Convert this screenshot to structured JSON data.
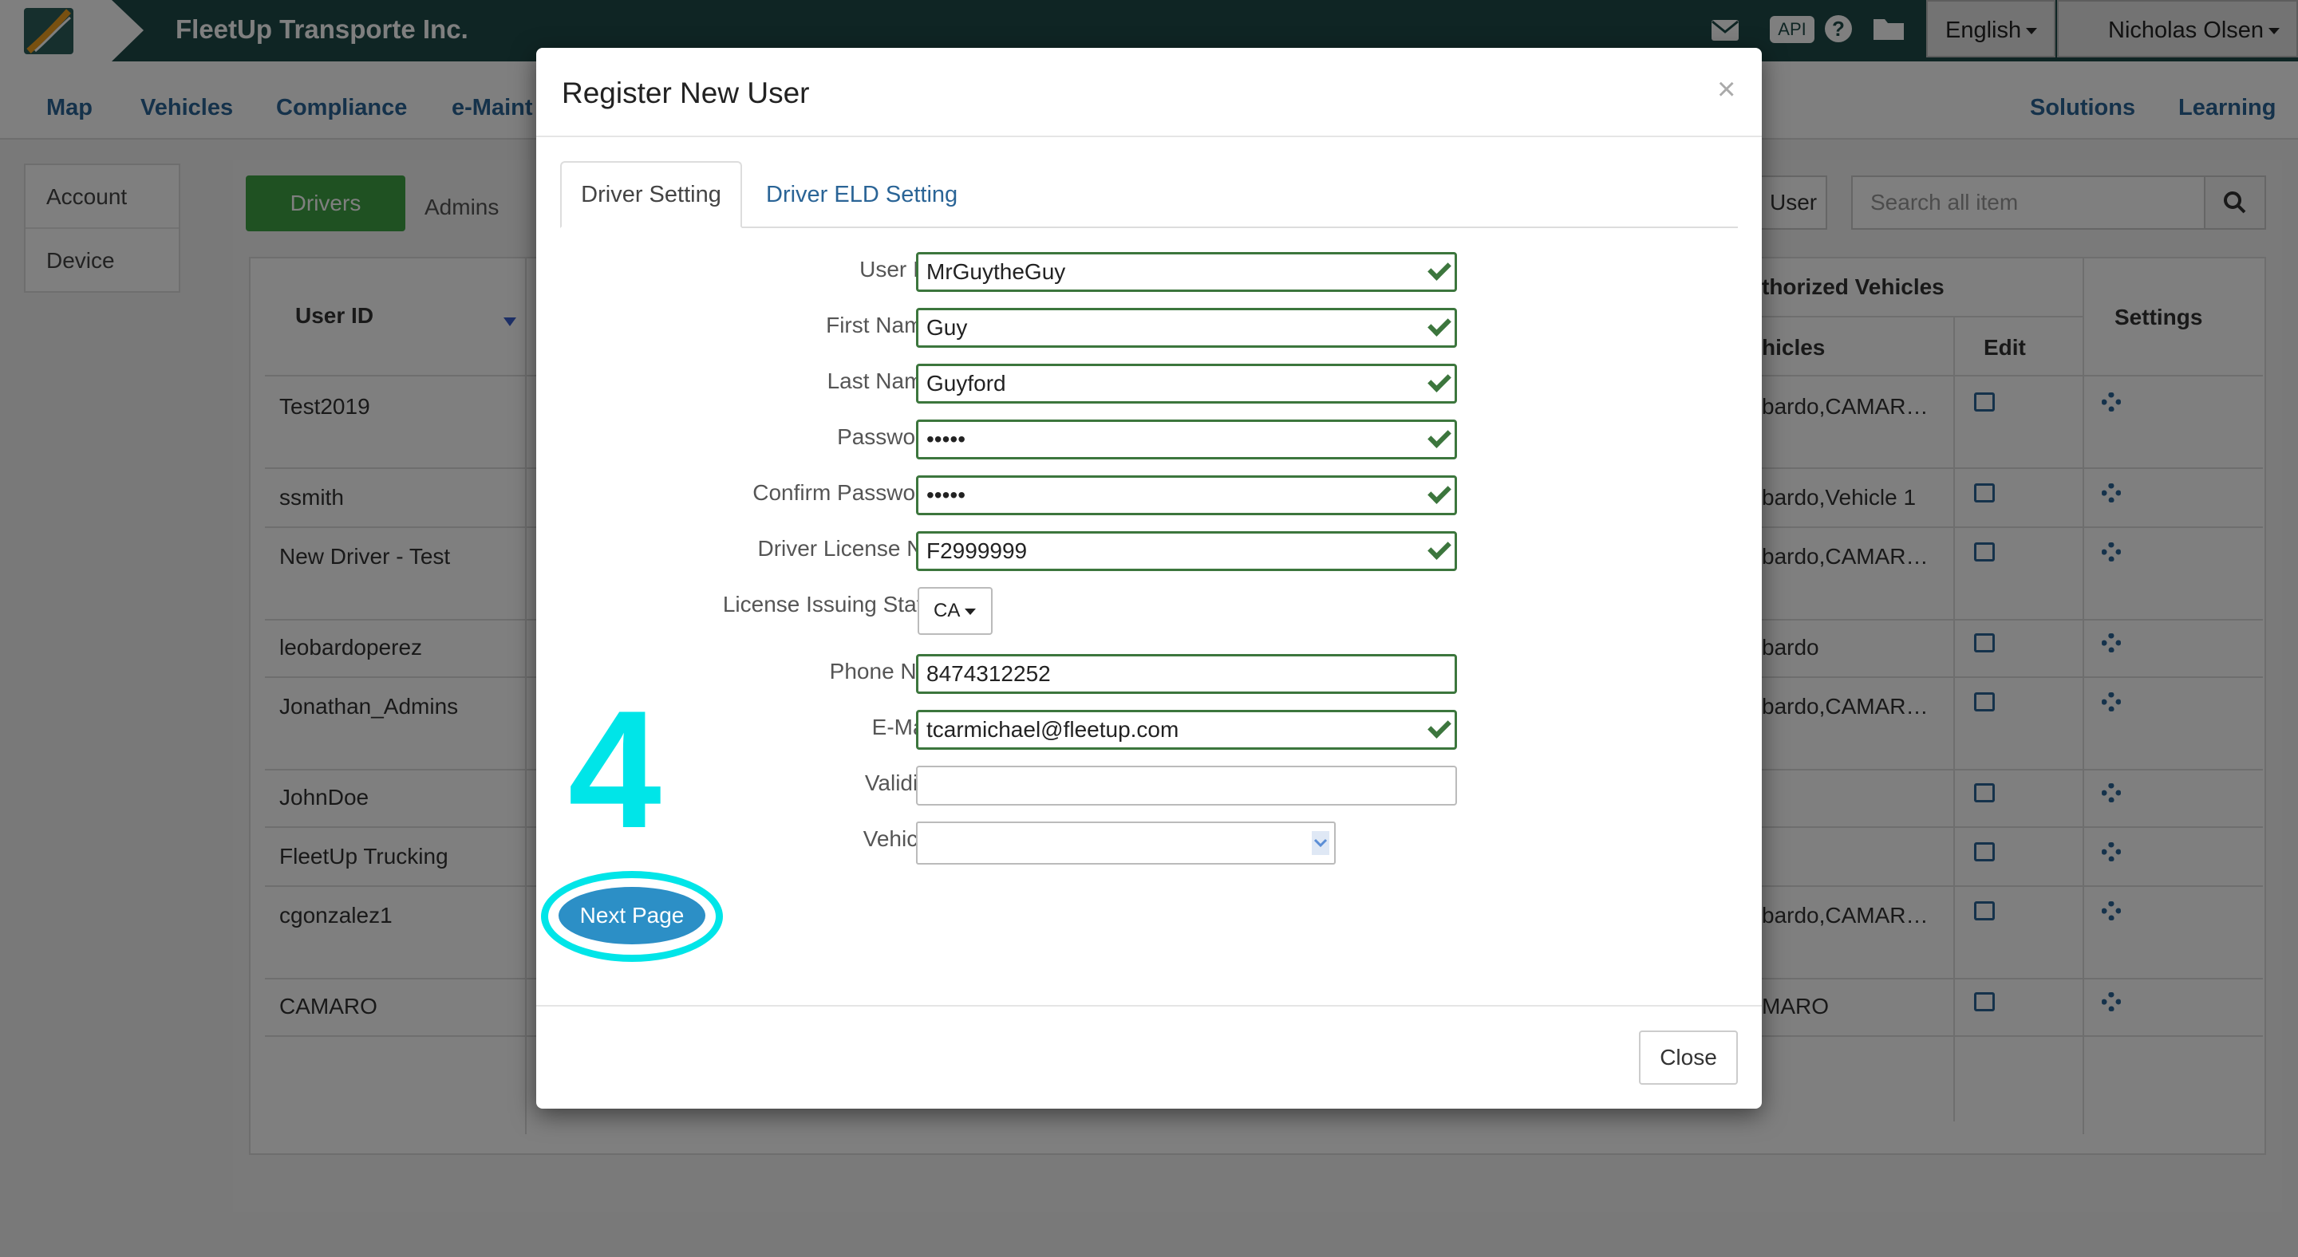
{
  "app": {
    "company_name": "FleetUp Transporte Inc."
  },
  "topbar": {
    "icons": [
      "mail-icon",
      "api-icon",
      "help-icon",
      "folder-icon"
    ],
    "api_label": "API",
    "language": "English",
    "user_name": "Nicholas Olsen"
  },
  "nav": {
    "items": [
      "Map",
      "Vehicles",
      "Compliance",
      "e-Maint",
      "Solutions",
      "Learning"
    ]
  },
  "left_menu": {
    "items": [
      "Account",
      "Device"
    ]
  },
  "page": {
    "tab_drivers": "Drivers",
    "tab_admins": "Admins",
    "add_user_label": "User",
    "search_placeholder": "Search all item"
  },
  "table": {
    "headers": {
      "user_id": "User ID",
      "authorized_vehicles": "thorized Vehicles",
      "vehicles": "hicles",
      "edit": "Edit",
      "settings": "Settings"
    },
    "rows": [
      {
        "user_id": "Test2019",
        "vehicles": "bardo,CAMAR…"
      },
      {
        "user_id": "ssmith",
        "vehicles": "bardo,Vehicle 1"
      },
      {
        "user_id": "New Driver - Test",
        "vehicles": "bardo,CAMAR…"
      },
      {
        "user_id": "leobardoperez",
        "vehicles": "bardo"
      },
      {
        "user_id": "Jonathan_Admins",
        "vehicles": "bardo,CAMAR…"
      },
      {
        "user_id": "JohnDoe",
        "vehicles": ""
      },
      {
        "user_id": "FleetUp Trucking",
        "vehicles": ""
      },
      {
        "user_id": "cgonzalez1",
        "vehicles": "bardo,CAMAR…"
      },
      {
        "user_id": "CAMARO",
        "vehicles": "MARO"
      }
    ]
  },
  "modal": {
    "title": "Register New User",
    "tabs": [
      "Driver Setting",
      "Driver ELD Setting"
    ],
    "fields": {
      "user_id": {
        "label": "User ID",
        "value": "MrGuytheGuy"
      },
      "first_name": {
        "label": "First Name",
        "value": "Guy"
      },
      "last_name": {
        "label": "Last Name",
        "value": "Guyford"
      },
      "password": {
        "label": "Password",
        "value": "•••••"
      },
      "confirm_password": {
        "label": "Confirm Password",
        "value": "•••••"
      },
      "license_no": {
        "label": "Driver License No",
        "value": "F2999999"
      },
      "license_state": {
        "label": "License Issuing State",
        "value": "CA"
      },
      "phone": {
        "label": "Phone No.",
        "value": "8474312252"
      },
      "email": {
        "label": "E-Mail",
        "value": "tcarmichael@fleetup.com"
      },
      "validity": {
        "label": "Validity",
        "value": ""
      },
      "vehicle": {
        "label": "Vehicle",
        "value": ""
      }
    },
    "annotation_step": "4",
    "next_label": "Next Page",
    "close_label": "Close"
  },
  "colors": {
    "topbar": "#1e4a48",
    "nav_link": "#2a6496",
    "drivers_tab": "#3fa244",
    "valid_border": "#3c763d",
    "annotation": "#00e5e8",
    "next_button": "#2c8fc6"
  }
}
